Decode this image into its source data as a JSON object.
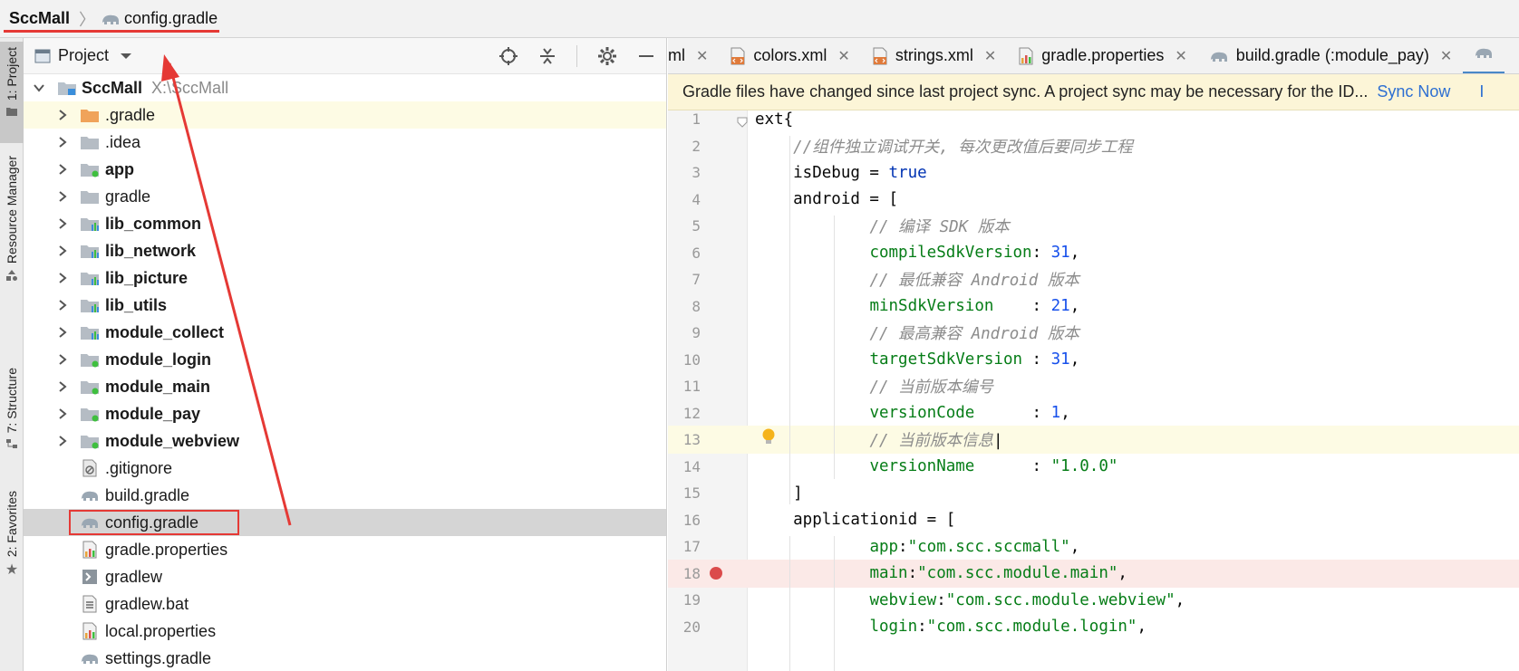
{
  "breadcrumb": {
    "project": "SccMall",
    "file": "config.gradle"
  },
  "toolstrip": {
    "tabs": [
      "1: Project",
      "Resource Manager",
      "7: Structure",
      "2: Favorites"
    ]
  },
  "project_panel": {
    "title": "Project",
    "root": {
      "name": "SccMall",
      "path": "X:\\SccMall"
    },
    "items": [
      {
        "label": ".gradle",
        "icon": "folder-orange-icon",
        "bold": false,
        "expandable": true
      },
      {
        "label": ".idea",
        "icon": "folder-icon",
        "bold": false,
        "expandable": true
      },
      {
        "label": "app",
        "icon": "module-app-icon",
        "bold": true,
        "expandable": true
      },
      {
        "label": "gradle",
        "icon": "folder-icon",
        "bold": false,
        "expandable": true
      },
      {
        "label": "lib_common",
        "icon": "module-lib-icon",
        "bold": true,
        "expandable": true
      },
      {
        "label": "lib_network",
        "icon": "module-lib-icon",
        "bold": true,
        "expandable": true
      },
      {
        "label": "lib_picture",
        "icon": "module-lib-icon",
        "bold": true,
        "expandable": true
      },
      {
        "label": "lib_utils",
        "icon": "module-lib-icon",
        "bold": true,
        "expandable": true
      },
      {
        "label": "module_collect",
        "icon": "module-lib-icon",
        "bold": true,
        "expandable": true
      },
      {
        "label": "module_login",
        "icon": "module-app-icon",
        "bold": true,
        "expandable": true
      },
      {
        "label": "module_main",
        "icon": "module-app-icon",
        "bold": true,
        "expandable": true
      },
      {
        "label": "module_pay",
        "icon": "module-app-icon",
        "bold": true,
        "expandable": true
      },
      {
        "label": "module_webview",
        "icon": "module-app-icon",
        "bold": true,
        "expandable": true
      },
      {
        "label": ".gitignore",
        "icon": "gitignore-icon",
        "bold": false,
        "expandable": false
      },
      {
        "label": "build.gradle",
        "icon": "gradle-elephant-icon",
        "bold": false,
        "expandable": false
      },
      {
        "label": "config.gradle",
        "icon": "gradle-elephant-icon",
        "bold": false,
        "expandable": false,
        "selected": true
      },
      {
        "label": "gradle.properties",
        "icon": "properties-icon",
        "bold": false,
        "expandable": false
      },
      {
        "label": "gradlew",
        "icon": "shell-icon",
        "bold": false,
        "expandable": false
      },
      {
        "label": "gradlew.bat",
        "icon": "text-file-icon",
        "bold": false,
        "expandable": false
      },
      {
        "label": "local.properties",
        "icon": "properties-icon",
        "bold": false,
        "expandable": false
      },
      {
        "label": "settings.gradle",
        "icon": "gradle-elephant-icon",
        "bold": false,
        "expandable": false
      }
    ]
  },
  "editor_tabs": [
    {
      "label": "ml",
      "icon": "",
      "close": "✕"
    },
    {
      "label": "colors.xml",
      "icon": "xml-icon",
      "close": "✕"
    },
    {
      "label": "strings.xml",
      "icon": "xml-icon",
      "close": "✕"
    },
    {
      "label": "gradle.properties",
      "icon": "properties-icon",
      "close": "✕"
    },
    {
      "label": "build.gradle (:module_pay)",
      "icon": "gradle-elephant-icon",
      "close": "✕"
    }
  ],
  "notification": {
    "message": "Gradle files have changed since last project sync. A project sync may be necessary for the ID...",
    "action": "Sync Now",
    "extra": "I"
  },
  "editor": {
    "lines": [
      {
        "n": "1",
        "tokens": [
          [
            "pl",
            "ext{"
          ]
        ]
      },
      {
        "n": "2",
        "tokens": [
          [
            "pl",
            "    "
          ],
          [
            "com",
            "//组件独立调试开关, 每次更改值后要同步工程"
          ]
        ]
      },
      {
        "n": "3",
        "tokens": [
          [
            "pl",
            "    isDebug = "
          ],
          [
            "kw",
            "true"
          ]
        ]
      },
      {
        "n": "4",
        "tokens": [
          [
            "pl",
            "    android = ["
          ]
        ]
      },
      {
        "n": "5",
        "tokens": [
          [
            "pl",
            "            "
          ],
          [
            "com",
            "// 编译 SDK 版本"
          ]
        ]
      },
      {
        "n": "6",
        "tokens": [
          [
            "pl",
            "            "
          ],
          [
            "key",
            "compileSdkVersion"
          ],
          [
            "pl",
            ": "
          ],
          [
            "num",
            "31"
          ],
          [
            "pl",
            ","
          ]
        ]
      },
      {
        "n": "7",
        "tokens": [
          [
            "pl",
            "            "
          ],
          [
            "com",
            "// 最低兼容 Android 版本"
          ]
        ]
      },
      {
        "n": "8",
        "tokens": [
          [
            "pl",
            "            "
          ],
          [
            "key",
            "minSdkVersion"
          ],
          [
            "pl",
            "    : "
          ],
          [
            "num",
            "21"
          ],
          [
            "pl",
            ","
          ]
        ]
      },
      {
        "n": "9",
        "tokens": [
          [
            "pl",
            "            "
          ],
          [
            "com",
            "// 最高兼容 Android 版本"
          ]
        ]
      },
      {
        "n": "10",
        "tokens": [
          [
            "pl",
            "            "
          ],
          [
            "key",
            "targetSdkVersion"
          ],
          [
            "pl",
            " : "
          ],
          [
            "num",
            "31"
          ],
          [
            "pl",
            ","
          ]
        ]
      },
      {
        "n": "11",
        "tokens": [
          [
            "pl",
            "            "
          ],
          [
            "com",
            "// 当前版本编号"
          ]
        ]
      },
      {
        "n": "12",
        "tokens": [
          [
            "pl",
            "            "
          ],
          [
            "key",
            "versionCode"
          ],
          [
            "pl",
            "      : "
          ],
          [
            "num",
            "1"
          ],
          [
            "pl",
            ","
          ]
        ]
      },
      {
        "n": "13",
        "tokens": [
          [
            "pl",
            "            "
          ],
          [
            "com",
            "// 当前版本信息"
          ],
          [
            "pl",
            "|"
          ]
        ]
      },
      {
        "n": "14",
        "tokens": [
          [
            "pl",
            "            "
          ],
          [
            "key",
            "versionName"
          ],
          [
            "pl",
            "      : "
          ],
          [
            "str",
            "\"1.0.0\""
          ]
        ]
      },
      {
        "n": "15",
        "tokens": [
          [
            "pl",
            "    ]"
          ]
        ]
      },
      {
        "n": "16",
        "tokens": [
          [
            "pl",
            "    applicationid = ["
          ]
        ]
      },
      {
        "n": "17",
        "tokens": [
          [
            "pl",
            "            "
          ],
          [
            "key",
            "app"
          ],
          [
            "pl",
            ":"
          ],
          [
            "str",
            "\"com.scc.sccmall\""
          ],
          [
            "pl",
            ","
          ]
        ]
      },
      {
        "n": "18",
        "tokens": [
          [
            "pl",
            "            "
          ],
          [
            "key",
            "main"
          ],
          [
            "pl",
            ":"
          ],
          [
            "str",
            "\"com.scc.module.main\""
          ],
          [
            "pl",
            ","
          ]
        ]
      },
      {
        "n": "19",
        "tokens": [
          [
            "pl",
            "            "
          ],
          [
            "key",
            "webview"
          ],
          [
            "pl",
            ":"
          ],
          [
            "str",
            "\"com.scc.module.webview\""
          ],
          [
            "pl",
            ","
          ]
        ]
      },
      {
        "n": "20",
        "tokens": [
          [
            "pl",
            "            "
          ],
          [
            "key",
            "login"
          ],
          [
            "pl",
            ":"
          ],
          [
            "str",
            "\"com.scc.module.login\""
          ],
          [
            "pl",
            ","
          ]
        ]
      }
    ],
    "current_line": "13",
    "breakpoint_line": "18",
    "bulb_line": "13"
  },
  "colors": {
    "annotation": "#e53935",
    "current_line_bg": "#fdfbe4",
    "breakpoint_bg": "#fbe9e7",
    "selected_row_bg": "#d5d5d5",
    "link": "#2d6fd2"
  }
}
